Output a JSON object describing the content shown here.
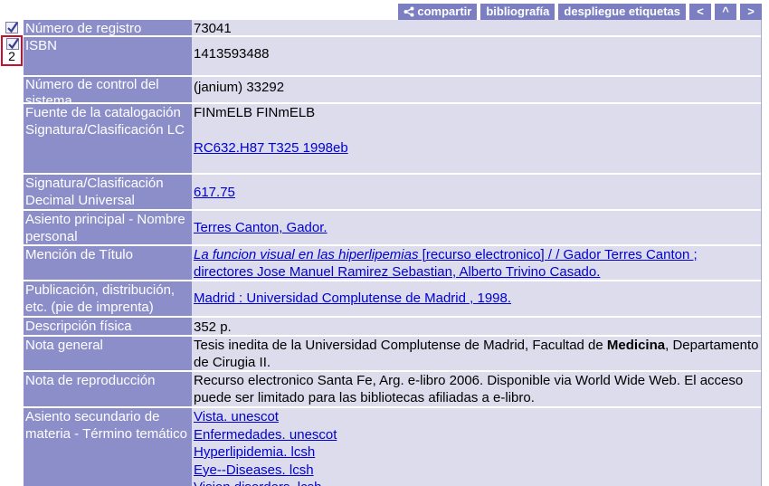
{
  "toolbar": {
    "share_label": "compartir",
    "bibliography_label": "bibliografía",
    "labels_label": "despliegue etiquetas",
    "prev_label": "<",
    "up_label": "^",
    "next_label": ">"
  },
  "record": {
    "number": "2",
    "fields": {
      "registro": {
        "label": "Número de registro",
        "value": "73041"
      },
      "isbn": {
        "label": "ISBN",
        "value": "1413593488"
      },
      "control": {
        "label": "Número de control del sistema",
        "value": "(janium) 33292"
      },
      "fuente": {
        "label": "Fuente de la catalogación",
        "value": "FINmELB FINmELB"
      },
      "lc": {
        "label": "Signatura/Clasificación LC",
        "value": "RC632.H87 T325 1998eb "
      },
      "cdu": {
        "label": "Signatura/Clasificación Decimal Universal",
        "value": "617.75"
      },
      "autor": {
        "label": "Asiento principal - Nombre personal",
        "value": "Terres Canton, Gador."
      },
      "titulo": {
        "label": "Mención de Título",
        "title_italic": "La funcion visual en las hiperlipemias",
        "rest": " [recurso electronico] / / Gador Terres Canton ; directores Jose Manuel Ramirez Sebastian, Alberto Trivino Casado."
      },
      "publicacion": {
        "label": "Publicación, distribución, etc. (pie de imprenta)",
        "value": "Madrid : Universidad Complutense de Madrid , 1998."
      },
      "descripcion": {
        "label": "Descripción física",
        "value": "352 p."
      },
      "nota_general": {
        "label": "Nota general",
        "before": "Tesis inedita de la Universidad Complutense de Madrid, Facultad de ",
        "bold": "Medicina",
        "after": ", Departamento de Cirugia II."
      },
      "nota_reproduccion": {
        "label": "Nota de reproducción",
        "value": "Recurso electronico Santa Fe, Arg. e-libro 2006. Disponible via World Wide Web. El acceso puede ser limitado para las bibliotecas afiliadas a e-libro."
      },
      "materia": {
        "label": "Asiento secundario de materia - Término temático",
        "items": [
          "Vista. unescot",
          "Enfermedades. unescot",
          "Hyperlipidemia. lcsh",
          "Eye--Diseases. lcsh",
          "Vision disorders. lcsh"
        ]
      }
    }
  }
}
